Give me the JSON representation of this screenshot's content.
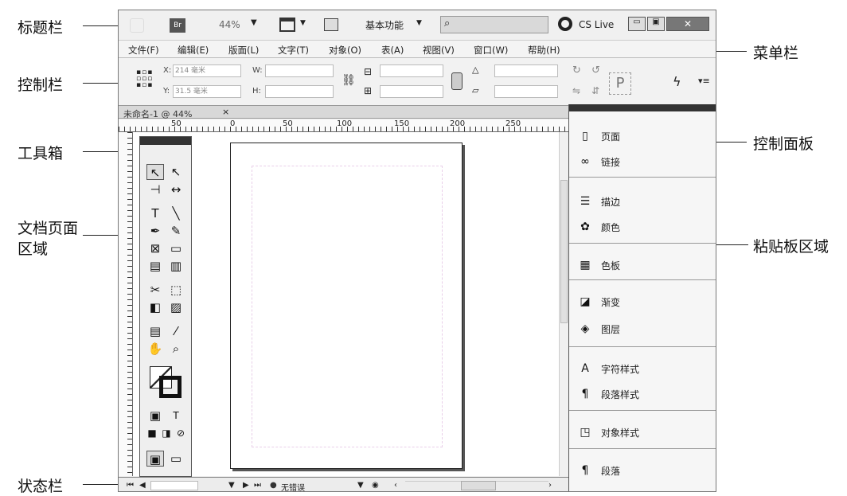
{
  "annotations": {
    "title_bar": "标题栏",
    "menu_bar": "菜单栏",
    "control_bar": "控制栏",
    "toolbox": "工具箱",
    "control_panel": "控制面板",
    "document_area_line1": "文档页面",
    "document_area_line2": "区域",
    "pasteboard_area": "粘贴板区域",
    "status_bar": "状态栏"
  },
  "titlebar": {
    "app_badge": "Br",
    "zoom": "44%",
    "workspace": "基本功能",
    "cs_live": "CS Live"
  },
  "menu": [
    "文件(F)",
    "编辑(E)",
    "版面(L)",
    "文字(T)",
    "对象(O)",
    "表(A)",
    "视图(V)",
    "窗口(W)",
    "帮助(H)"
  ],
  "control": {
    "x_label": "X:",
    "x_value": "214 毫米",
    "y_label": "Y:",
    "y_value": "31.5 毫米",
    "w_label": "W:",
    "h_label": "H:"
  },
  "document": {
    "tab_title": "未命名-1 @ 44%",
    "tab_close": "×",
    "ruler_marks": [
      "50",
      "0",
      "50",
      "100",
      "150",
      "200",
      "250"
    ]
  },
  "panel": {
    "items": [
      {
        "icon": "pages-icon",
        "label": "页面"
      },
      {
        "icon": "links-icon",
        "label": "链接"
      },
      {
        "icon": "stroke-icon",
        "label": "描边"
      },
      {
        "icon": "color-icon",
        "label": "颜色"
      },
      {
        "icon": "swatches-icon",
        "label": "色板"
      },
      {
        "icon": "gradient-icon",
        "label": "渐变"
      },
      {
        "icon": "layers-icon",
        "label": "图层"
      },
      {
        "icon": "character-styles-icon",
        "label": "字符样式"
      },
      {
        "icon": "paragraph-styles-icon",
        "label": "段落样式"
      },
      {
        "icon": "object-styles-icon",
        "label": "对象样式"
      },
      {
        "icon": "paragraph-icon",
        "label": "段落"
      }
    ]
  },
  "statusbar": {
    "preflight": "无错误"
  }
}
